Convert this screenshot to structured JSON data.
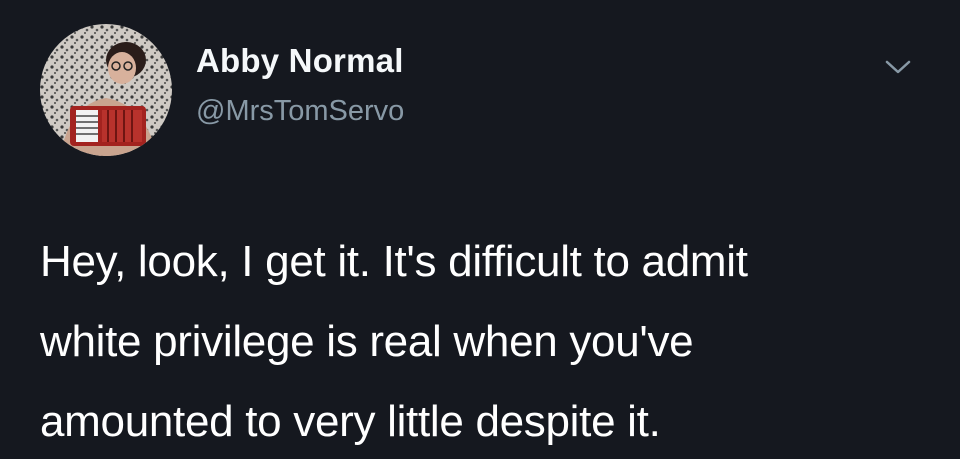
{
  "tweet": {
    "display_name": "Abby Normal",
    "handle": "@MrsTomServo",
    "text_lines": [
      "Hey, look, I get it. It's difficult to admit",
      "white privilege is real when you've",
      "amounted to very little despite it."
    ]
  },
  "icons": {
    "avatar": "profile-photo",
    "menu": "chevron-down-icon"
  },
  "colors": {
    "background": "#15181f",
    "name": "#f5f8fa",
    "handle": "#8899a6",
    "text": "#ffffff"
  }
}
